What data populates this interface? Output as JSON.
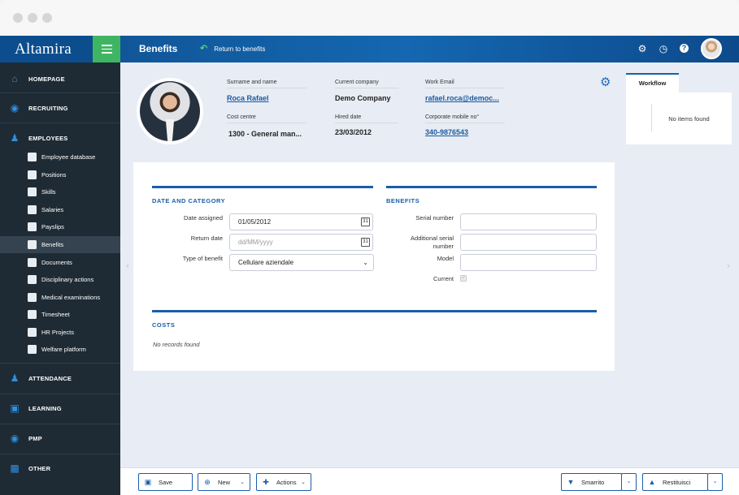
{
  "app": {
    "logo": "Altamira",
    "page_title": "Benefits",
    "return_link": "Return to benefits"
  },
  "sidebar": {
    "sections": [
      {
        "label": "HOMEPAGE",
        "icon": "home-icon"
      },
      {
        "label": "RECRUITING",
        "icon": "recruiting-icon"
      },
      {
        "label": "EMPLOYEES",
        "icon": "employees-icon"
      },
      {
        "label": "ATTENDANCE",
        "icon": "attendance-icon"
      },
      {
        "label": "LEARNING",
        "icon": "learning-icon"
      },
      {
        "label": "PMP",
        "icon": "pmp-icon"
      },
      {
        "label": "OTHER",
        "icon": "other-icon"
      }
    ],
    "items": [
      {
        "label": "Employee database",
        "icon": "database-icon"
      },
      {
        "label": "Positions",
        "icon": "org-chart-icon"
      },
      {
        "label": "Skills",
        "icon": "skills-icon"
      },
      {
        "label": "Salaries",
        "icon": "salaries-icon"
      },
      {
        "label": "Payslips",
        "icon": "payslips-icon"
      },
      {
        "label": "Benefits",
        "icon": "benefits-icon"
      },
      {
        "label": "Documents",
        "icon": "documents-icon"
      },
      {
        "label": "Disciplinary actions",
        "icon": "disciplinary-icon"
      },
      {
        "label": "Medical examinations",
        "icon": "medical-icon"
      },
      {
        "label": "Timesheet",
        "icon": "timesheet-icon"
      },
      {
        "label": "HR Projects",
        "icon": "rocket-icon"
      },
      {
        "label": "Welfare platform",
        "icon": "welfare-icon"
      }
    ]
  },
  "employee": {
    "surname_label": "Surname and name",
    "surname_value": "Roca Rafael",
    "cost_centre_label": "Cost centre",
    "cost_centre_value": "1300 - General man...",
    "company_label": "Current company",
    "company_value": "Demo Company",
    "hired_label": "Hired date",
    "hired_value": "23/03/2012",
    "email_label": "Work Email",
    "email_value": "rafael.roca@democ...",
    "mobile_label": "Corporate mobile no°",
    "mobile_value": "340-9876543"
  },
  "workflow": {
    "tab_label": "Workflow",
    "empty_text": "No items found"
  },
  "form": {
    "date_section_title": "DATE AND CATEGORY",
    "date_assigned_label": "Date assigned",
    "date_assigned_value": "01/05/2012",
    "return_date_label": "Return date",
    "return_date_placeholder": "dd/MM/yyyy",
    "type_label": "Type of benefit",
    "type_value": "Cellulare aziendale",
    "benefits_section_title": "BENEFITS",
    "serial_label": "Serial number",
    "serial_value": "",
    "additional_serial_label": "Additional serial number",
    "additional_serial_value": "",
    "model_label": "Model",
    "model_value": "",
    "current_label": "Current",
    "costs_section_title": "COSTS",
    "no_records": "No records found",
    "calendar_glyph": "31"
  },
  "toolbar": {
    "save": "Save",
    "new": "New",
    "actions": "Actions",
    "smarrito": "Smarrito",
    "restituisci": "Restituisci"
  },
  "colors": {
    "primary": "#1a5ea8",
    "accent_green": "#3fb563",
    "sidebar_bg": "#1e2b35"
  }
}
